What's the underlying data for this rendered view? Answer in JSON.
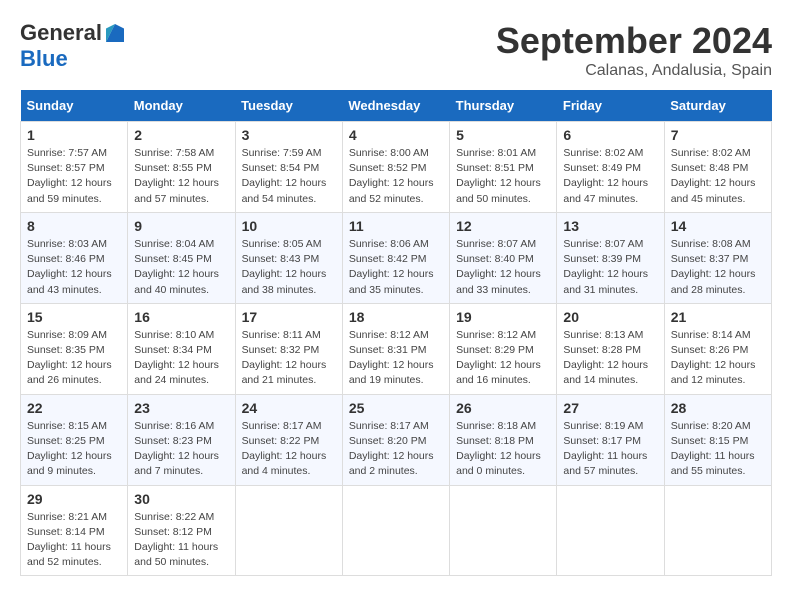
{
  "logo": {
    "general": "General",
    "blue": "Blue"
  },
  "title": "September 2024",
  "subtitle": "Calanas, Andalusia, Spain",
  "days_header": [
    "Sunday",
    "Monday",
    "Tuesday",
    "Wednesday",
    "Thursday",
    "Friday",
    "Saturday"
  ],
  "weeks": [
    [
      {
        "day": "1",
        "info": "Sunrise: 7:57 AM\nSunset: 8:57 PM\nDaylight: 12 hours\nand 59 minutes."
      },
      {
        "day": "2",
        "info": "Sunrise: 7:58 AM\nSunset: 8:55 PM\nDaylight: 12 hours\nand 57 minutes."
      },
      {
        "day": "3",
        "info": "Sunrise: 7:59 AM\nSunset: 8:54 PM\nDaylight: 12 hours\nand 54 minutes."
      },
      {
        "day": "4",
        "info": "Sunrise: 8:00 AM\nSunset: 8:52 PM\nDaylight: 12 hours\nand 52 minutes."
      },
      {
        "day": "5",
        "info": "Sunrise: 8:01 AM\nSunset: 8:51 PM\nDaylight: 12 hours\nand 50 minutes."
      },
      {
        "day": "6",
        "info": "Sunrise: 8:02 AM\nSunset: 8:49 PM\nDaylight: 12 hours\nand 47 minutes."
      },
      {
        "day": "7",
        "info": "Sunrise: 8:02 AM\nSunset: 8:48 PM\nDaylight: 12 hours\nand 45 minutes."
      }
    ],
    [
      {
        "day": "8",
        "info": "Sunrise: 8:03 AM\nSunset: 8:46 PM\nDaylight: 12 hours\nand 43 minutes."
      },
      {
        "day": "9",
        "info": "Sunrise: 8:04 AM\nSunset: 8:45 PM\nDaylight: 12 hours\nand 40 minutes."
      },
      {
        "day": "10",
        "info": "Sunrise: 8:05 AM\nSunset: 8:43 PM\nDaylight: 12 hours\nand 38 minutes."
      },
      {
        "day": "11",
        "info": "Sunrise: 8:06 AM\nSunset: 8:42 PM\nDaylight: 12 hours\nand 35 minutes."
      },
      {
        "day": "12",
        "info": "Sunrise: 8:07 AM\nSunset: 8:40 PM\nDaylight: 12 hours\nand 33 minutes."
      },
      {
        "day": "13",
        "info": "Sunrise: 8:07 AM\nSunset: 8:39 PM\nDaylight: 12 hours\nand 31 minutes."
      },
      {
        "day": "14",
        "info": "Sunrise: 8:08 AM\nSunset: 8:37 PM\nDaylight: 12 hours\nand 28 minutes."
      }
    ],
    [
      {
        "day": "15",
        "info": "Sunrise: 8:09 AM\nSunset: 8:35 PM\nDaylight: 12 hours\nand 26 minutes."
      },
      {
        "day": "16",
        "info": "Sunrise: 8:10 AM\nSunset: 8:34 PM\nDaylight: 12 hours\nand 24 minutes."
      },
      {
        "day": "17",
        "info": "Sunrise: 8:11 AM\nSunset: 8:32 PM\nDaylight: 12 hours\nand 21 minutes."
      },
      {
        "day": "18",
        "info": "Sunrise: 8:12 AM\nSunset: 8:31 PM\nDaylight: 12 hours\nand 19 minutes."
      },
      {
        "day": "19",
        "info": "Sunrise: 8:12 AM\nSunset: 8:29 PM\nDaylight: 12 hours\nand 16 minutes."
      },
      {
        "day": "20",
        "info": "Sunrise: 8:13 AM\nSunset: 8:28 PM\nDaylight: 12 hours\nand 14 minutes."
      },
      {
        "day": "21",
        "info": "Sunrise: 8:14 AM\nSunset: 8:26 PM\nDaylight: 12 hours\nand 12 minutes."
      }
    ],
    [
      {
        "day": "22",
        "info": "Sunrise: 8:15 AM\nSunset: 8:25 PM\nDaylight: 12 hours\nand 9 minutes."
      },
      {
        "day": "23",
        "info": "Sunrise: 8:16 AM\nSunset: 8:23 PM\nDaylight: 12 hours\nand 7 minutes."
      },
      {
        "day": "24",
        "info": "Sunrise: 8:17 AM\nSunset: 8:22 PM\nDaylight: 12 hours\nand 4 minutes."
      },
      {
        "day": "25",
        "info": "Sunrise: 8:17 AM\nSunset: 8:20 PM\nDaylight: 12 hours\nand 2 minutes."
      },
      {
        "day": "26",
        "info": "Sunrise: 8:18 AM\nSunset: 8:18 PM\nDaylight: 12 hours\nand 0 minutes."
      },
      {
        "day": "27",
        "info": "Sunrise: 8:19 AM\nSunset: 8:17 PM\nDaylight: 11 hours\nand 57 minutes."
      },
      {
        "day": "28",
        "info": "Sunrise: 8:20 AM\nSunset: 8:15 PM\nDaylight: 11 hours\nand 55 minutes."
      }
    ],
    [
      {
        "day": "29",
        "info": "Sunrise: 8:21 AM\nSunset: 8:14 PM\nDaylight: 11 hours\nand 52 minutes."
      },
      {
        "day": "30",
        "info": "Sunrise: 8:22 AM\nSunset: 8:12 PM\nDaylight: 11 hours\nand 50 minutes."
      },
      {
        "day": "",
        "info": ""
      },
      {
        "day": "",
        "info": ""
      },
      {
        "day": "",
        "info": ""
      },
      {
        "day": "",
        "info": ""
      },
      {
        "day": "",
        "info": ""
      }
    ]
  ]
}
